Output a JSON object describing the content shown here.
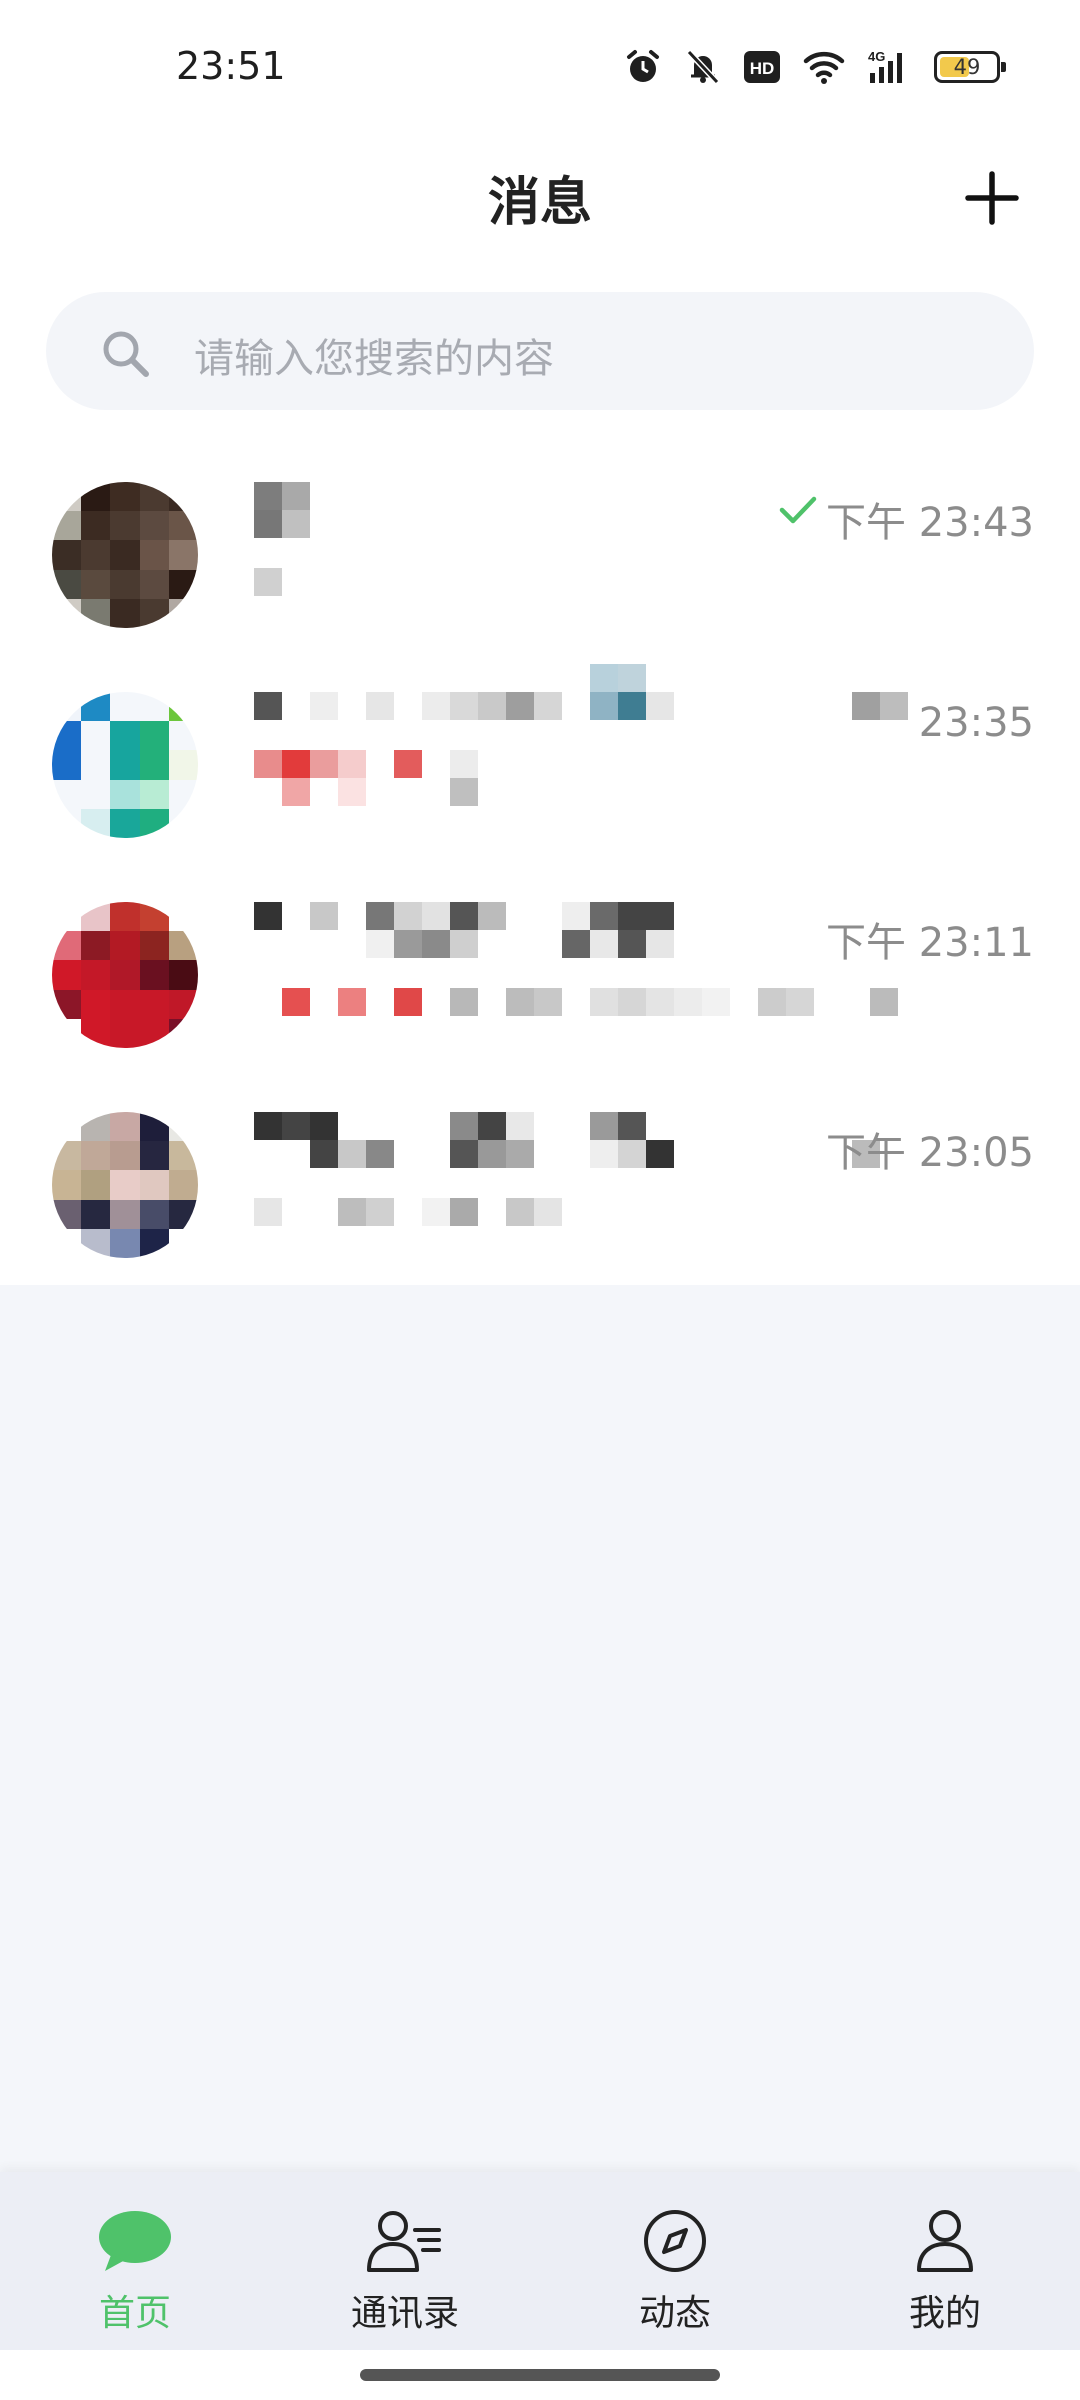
{
  "status_bar": {
    "time": "23:51",
    "battery_level": "49",
    "icons": [
      "alarm-icon",
      "mute-icon",
      "hd-icon",
      "wifi-icon",
      "signal-4g-icon",
      "battery-icon"
    ]
  },
  "header": {
    "title": "消息",
    "add_icon": "plus-icon"
  },
  "search": {
    "placeholder": "请输入您搜索的内容",
    "icon": "search-icon"
  },
  "conversations": [
    {
      "time": "下午 23:43",
      "read": true
    },
    {
      "time": "23:35",
      "read": false
    },
    {
      "time": "下午 23:11",
      "read": false
    },
    {
      "time": "下午 23:05",
      "read": false
    }
  ],
  "bottom_nav": {
    "items": [
      {
        "label": "首页",
        "icon": "chat-bubble-icon",
        "active": true
      },
      {
        "label": "通讯录",
        "icon": "contacts-icon",
        "active": false
      },
      {
        "label": "动态",
        "icon": "compass-icon",
        "active": false
      },
      {
        "label": "我的",
        "icon": "person-icon",
        "active": false
      }
    ]
  },
  "colors": {
    "accent": "#4fc26a",
    "background": "#f4f6fa",
    "nav_background": "#eceef5"
  }
}
